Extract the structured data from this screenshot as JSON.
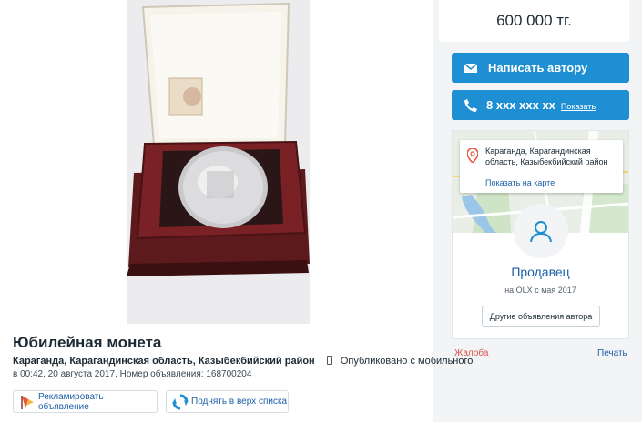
{
  "listing": {
    "title": "Юбилейная монета",
    "location": "Караганда, Карагандинская область, Казыбекбийский район",
    "published_via": "Опубликовано с мобильного",
    "published_meta": "в 00:42, 20 августа 2017, Номер объявления: 168700204"
  },
  "actions": {
    "promote_label": "Рекламировать объявление",
    "raise_label": "Поднять в верх списка"
  },
  "sidebar": {
    "price": "600 000 тг.",
    "write_author_label": "Написать автору",
    "phone_masked": "8 xxx xxx xx",
    "phone_show_label": "Показать",
    "location_text": "Караганда, Карагандинская область, Казыбекбийский район",
    "show_on_map_label": "Показать на карте",
    "seller_name": "Продавец",
    "seller_since": "на OLX с мая 2017",
    "other_ads_label": "Другие объявления автора",
    "complain_label": "Жалоба",
    "print_label": "Печать"
  },
  "colors": {
    "accent_blue": "#1f8fd3",
    "link_blue": "#1b5fa6",
    "complain_red": "#d9534f"
  },
  "icons": [
    "product-photo",
    "promote-icon",
    "raise-icon",
    "mail-icon",
    "phone-icon",
    "map-pin-icon",
    "user-icon",
    "mobile-icon"
  ]
}
